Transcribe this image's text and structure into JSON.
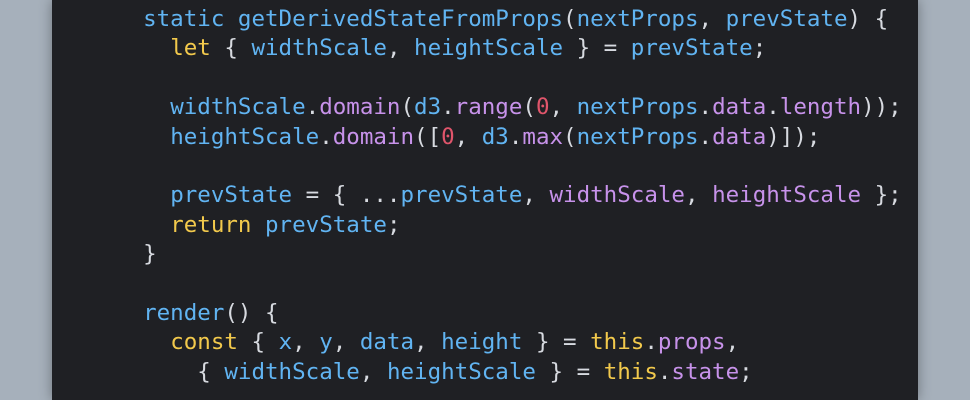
{
  "editor": {
    "lines": [
      {
        "tokens": [
          {
            "t": "  ",
            "c": "pun"
          },
          {
            "t": "static",
            "c": "fn"
          },
          {
            "t": " ",
            "c": "pun"
          },
          {
            "t": "getDerivedStateFromProps",
            "c": "fn"
          },
          {
            "t": "(",
            "c": "pun"
          },
          {
            "t": "nextProps",
            "c": "var"
          },
          {
            "t": ", ",
            "c": "pun"
          },
          {
            "t": "prevState",
            "c": "var"
          },
          {
            "t": ") {",
            "c": "pun"
          }
        ]
      },
      {
        "tokens": [
          {
            "t": "    ",
            "c": "pun"
          },
          {
            "t": "let",
            "c": "kw"
          },
          {
            "t": " { ",
            "c": "pun"
          },
          {
            "t": "widthScale",
            "c": "var"
          },
          {
            "t": ", ",
            "c": "pun"
          },
          {
            "t": "heightScale",
            "c": "var"
          },
          {
            "t": " } = ",
            "c": "pun"
          },
          {
            "t": "prevState",
            "c": "var"
          },
          {
            "t": ";",
            "c": "pun"
          }
        ]
      },
      {
        "tokens": []
      },
      {
        "tokens": [
          {
            "t": "    ",
            "c": "pun"
          },
          {
            "t": "widthScale",
            "c": "var"
          },
          {
            "t": ".",
            "c": "pun"
          },
          {
            "t": "domain",
            "c": "prop"
          },
          {
            "t": "(",
            "c": "pun"
          },
          {
            "t": "d3",
            "c": "var"
          },
          {
            "t": ".",
            "c": "pun"
          },
          {
            "t": "range",
            "c": "prop"
          },
          {
            "t": "(",
            "c": "pun"
          },
          {
            "t": "0",
            "c": "num"
          },
          {
            "t": ", ",
            "c": "pun"
          },
          {
            "t": "nextProps",
            "c": "var"
          },
          {
            "t": ".",
            "c": "pun"
          },
          {
            "t": "data",
            "c": "prop"
          },
          {
            "t": ".",
            "c": "pun"
          },
          {
            "t": "length",
            "c": "prop"
          },
          {
            "t": "));",
            "c": "pun"
          }
        ]
      },
      {
        "tokens": [
          {
            "t": "    ",
            "c": "pun"
          },
          {
            "t": "heightScale",
            "c": "var"
          },
          {
            "t": ".",
            "c": "pun"
          },
          {
            "t": "domain",
            "c": "prop"
          },
          {
            "t": "([",
            "c": "pun"
          },
          {
            "t": "0",
            "c": "num"
          },
          {
            "t": ", ",
            "c": "pun"
          },
          {
            "t": "d3",
            "c": "var"
          },
          {
            "t": ".",
            "c": "pun"
          },
          {
            "t": "max",
            "c": "prop"
          },
          {
            "t": "(",
            "c": "pun"
          },
          {
            "t": "nextProps",
            "c": "var"
          },
          {
            "t": ".",
            "c": "pun"
          },
          {
            "t": "data",
            "c": "prop"
          },
          {
            "t": ")]);",
            "c": "pun"
          }
        ]
      },
      {
        "tokens": []
      },
      {
        "tokens": [
          {
            "t": "    ",
            "c": "pun"
          },
          {
            "t": "prevState",
            "c": "var"
          },
          {
            "t": " = { ...",
            "c": "pun"
          },
          {
            "t": "prevState",
            "c": "var"
          },
          {
            "t": ", ",
            "c": "pun"
          },
          {
            "t": "widthScale",
            "c": "prop"
          },
          {
            "t": ", ",
            "c": "pun"
          },
          {
            "t": "heightScale",
            "c": "prop"
          },
          {
            "t": " };",
            "c": "pun"
          }
        ]
      },
      {
        "tokens": [
          {
            "t": "    ",
            "c": "pun"
          },
          {
            "t": "return",
            "c": "kw"
          },
          {
            "t": " ",
            "c": "pun"
          },
          {
            "t": "prevState",
            "c": "var"
          },
          {
            "t": ";",
            "c": "pun"
          }
        ]
      },
      {
        "tokens": [
          {
            "t": "  }",
            "c": "pun"
          }
        ]
      },
      {
        "tokens": []
      },
      {
        "tokens": [
          {
            "t": "  ",
            "c": "pun"
          },
          {
            "t": "render",
            "c": "fn"
          },
          {
            "t": "() {",
            "c": "pun"
          }
        ]
      },
      {
        "tokens": [
          {
            "t": "    ",
            "c": "pun"
          },
          {
            "t": "const",
            "c": "kw"
          },
          {
            "t": " { ",
            "c": "pun"
          },
          {
            "t": "x",
            "c": "var"
          },
          {
            "t": ", ",
            "c": "pun"
          },
          {
            "t": "y",
            "c": "var"
          },
          {
            "t": ", ",
            "c": "pun"
          },
          {
            "t": "data",
            "c": "var"
          },
          {
            "t": ", ",
            "c": "pun"
          },
          {
            "t": "height",
            "c": "var"
          },
          {
            "t": " } = ",
            "c": "pun"
          },
          {
            "t": "this",
            "c": "kw"
          },
          {
            "t": ".",
            "c": "pun"
          },
          {
            "t": "props",
            "c": "prop"
          },
          {
            "t": ",",
            "c": "pun"
          }
        ]
      },
      {
        "tokens": [
          {
            "t": "      { ",
            "c": "pun"
          },
          {
            "t": "widthScale",
            "c": "var"
          },
          {
            "t": ", ",
            "c": "pun"
          },
          {
            "t": "heightScale",
            "c": "var"
          },
          {
            "t": " } = ",
            "c": "pun"
          },
          {
            "t": "this",
            "c": "kw"
          },
          {
            "t": ".",
            "c": "pun"
          },
          {
            "t": "state",
            "c": "prop"
          },
          {
            "t": ";",
            "c": "pun"
          }
        ]
      }
    ]
  },
  "colors": {
    "background": "#a6b0bb",
    "editor_bg": "#1f2024",
    "keyword": "#f2c94c",
    "identifier": "#61b4f2",
    "property": "#c792ea",
    "number": "#e0556b",
    "punctuation": "#d7dae0"
  }
}
